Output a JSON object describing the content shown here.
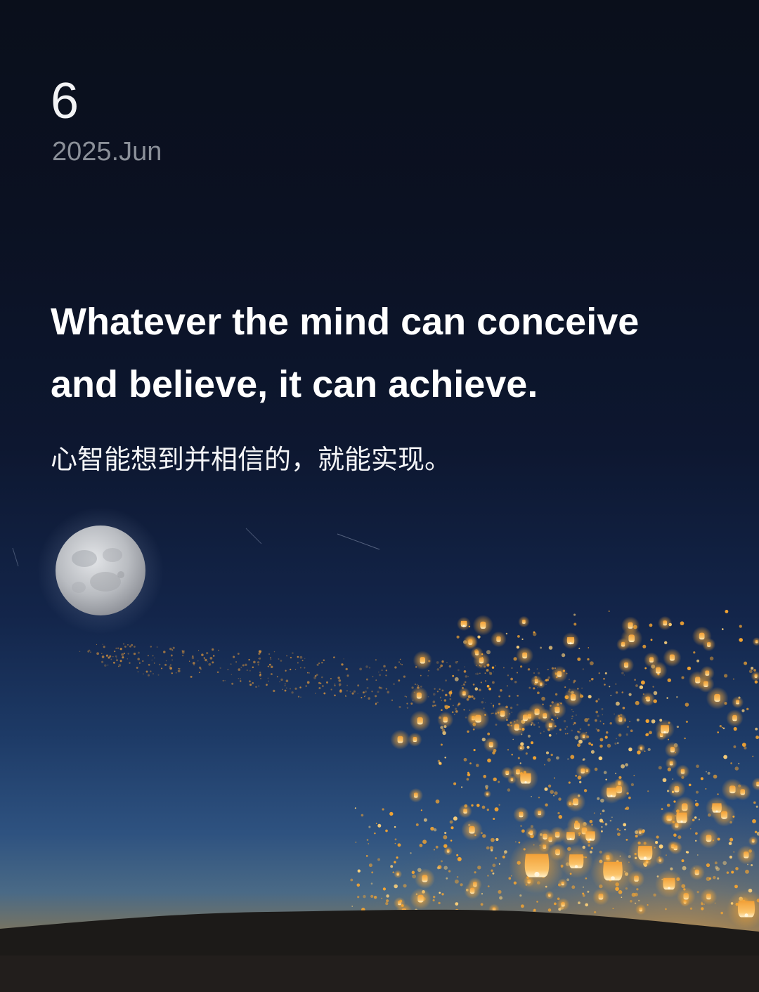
{
  "date": {
    "day": "6",
    "year_month": "2025.Jun"
  },
  "quote": {
    "english": "Whatever the mind can conceive and believe, it can achieve.",
    "chinese": "心智能想到并相信的，就能实现。"
  },
  "scene": {
    "background": "night sky with full moon and floating sky lanterns above a dark hill",
    "sky_top_color": "#0a0f1b",
    "sky_horizon_color": "#4a6a86",
    "lantern_color": "#f5a531",
    "moon_color": "#c9cbcf",
    "ground_color": "#1c1a18"
  }
}
